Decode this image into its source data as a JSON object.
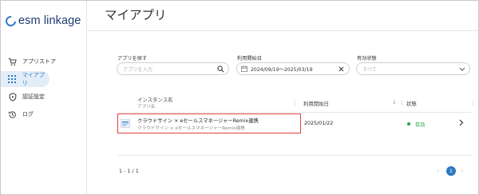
{
  "app": {
    "logo_text": "esm linkage",
    "brand_color": "#2b79c2"
  },
  "sidebar": {
    "items": [
      {
        "label": "アプリストア",
        "icon": "cart-icon"
      },
      {
        "label": "マイアプリ",
        "icon": "grid-icon",
        "active": true
      },
      {
        "label": "認証設定",
        "icon": "shield-icon"
      },
      {
        "label": "ログ",
        "icon": "history-icon"
      }
    ]
  },
  "header": {
    "title": "マイアプリ"
  },
  "filters": {
    "app_search": {
      "label": "アプリを探す",
      "placeholder": "アプリを入力",
      "value": ""
    },
    "date_range": {
      "label": "利用開始日",
      "value": "2024/09/19～2025/03/19"
    },
    "status": {
      "label": "有効状態",
      "placeholder": "すべて"
    }
  },
  "table": {
    "columns": {
      "instance_name": "インスタンス名",
      "instance_sub": "アプリ名",
      "start_date": "利用開始日",
      "status": "状態"
    },
    "rows": [
      {
        "name": "クラウドサイン × eセールスマネージャーRemix連携",
        "app": "クラウドサイン × eセールスマネージャーRemix連携",
        "start_date": "2025/01/22",
        "status": "有効"
      }
    ]
  },
  "pagination": {
    "info": "1 - 1 / 1",
    "current_page": "1"
  }
}
